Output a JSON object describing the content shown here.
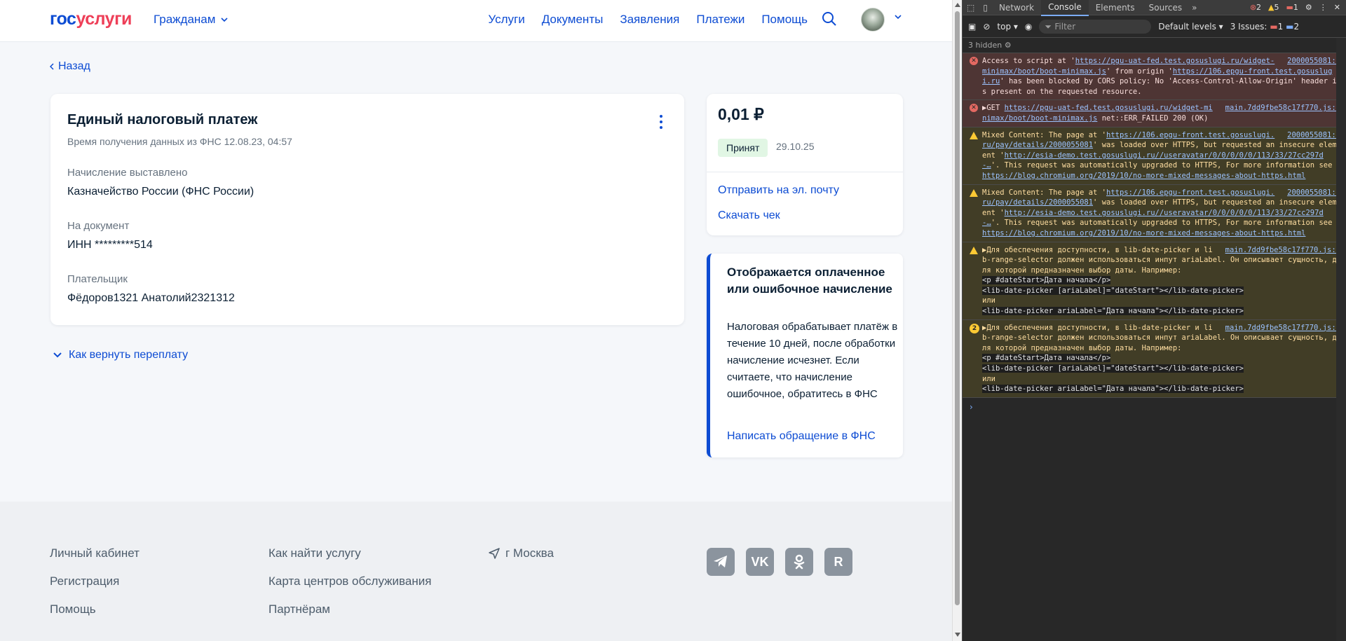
{
  "header": {
    "logo_part1": "гос",
    "logo_part2": "услуги",
    "citizens": "Гражданам",
    "nav": [
      "Услуги",
      "Документы",
      "Заявления",
      "Платежи",
      "Помощь"
    ]
  },
  "back": "Назад",
  "payment": {
    "title": "Единый налоговый платеж",
    "subtitle": "Время получения данных из ФНС 12.08.23, 04:57",
    "fields": [
      {
        "label": "Начисление выставлено",
        "value": "Казначейство России (ФНС России)"
      },
      {
        "label": "На документ",
        "value": "ИНН *********514"
      },
      {
        "label": "Плательщик",
        "value": "Фёдоров1321 Анатолий2321312"
      }
    ],
    "refund_link": "Как вернуть переплату"
  },
  "summary": {
    "amount": "0,01 ₽",
    "status": "Принят",
    "date": "29.10.25",
    "send_email": "Отправить на эл. почту",
    "download": "Скачать чек"
  },
  "info": {
    "title": "Отображается оплаченное или ошибочное начисление",
    "text": "Налоговая обрабатывает платёж в течение 10 дней, после обработки начисление исчезнет. Если считаете, что начисление ошибочное, обратитесь в ФНС",
    "link": "Написать обращение в ФНС"
  },
  "footer": {
    "col1": [
      "Личный кабинет",
      "Регистрация",
      "Помощь"
    ],
    "col2": [
      "Как найти услугу",
      "Карта центров обслуживания",
      "Партнёрам"
    ],
    "location": "г Москва",
    "socials": [
      "telegram-icon",
      "vk-icon",
      "odnoklassniki-icon",
      "rutube-icon"
    ]
  },
  "devtools": {
    "tabs": [
      "Network",
      "Console",
      "Elements",
      "Sources"
    ],
    "counts": {
      "errors": "2",
      "warnings": "5",
      "issues": "1"
    },
    "context": "top",
    "filter_placeholder": "Filter",
    "levels": "Default levels",
    "issues_label": "3 Issues:",
    "issues_err": "1",
    "issues_info": "2",
    "hidden": "3 hidden",
    "messages": [
      {
        "type": "error",
        "src": "2000055081:1",
        "parts": [
          "Access to script at '",
          "https://pgu-uat-fed.test.gosuslugi.ru/widget-minimax/boot/boot-minimax.js",
          "' from origin '",
          "https://106.epgu-front.test.gosuslugi.ru",
          "' has been blocked by CORS policy: No 'Access-Control-Allow-Origin' header is present on the requested resource."
        ]
      },
      {
        "type": "error",
        "src": "main.7dd9fbe58c17f770.js:1",
        "parts": [
          "▶GET ",
          "https://pgu-uat-fed.test.gosuslugi.ru/widget-minimax/boot/boot-minimax.js",
          " net::ERR_FAILED 200 (OK)"
        ]
      },
      {
        "type": "warn",
        "src": "2000055081:1",
        "parts": [
          "Mixed Content: The page at '",
          "https://106.epgu-front.test.gosuslugi.ru/pay/details/2000055081",
          "' was loaded over HTTPS, but requested an insecure element '",
          "http://esia-demo.test.gosuslugi.ru//useravatar/0/0/0/0/0/113/33/27cc297d-…",
          "'. This request was automatically upgraded to HTTPS, For more information see ",
          "https://blog.chromium.org/2019/10/no-more-mixed-messages-about-https.html"
        ]
      },
      {
        "type": "warn",
        "src": "2000055081:1",
        "parts": [
          "Mixed Content: The page at '",
          "https://106.epgu-front.test.gosuslugi.ru/pay/details/2000055081",
          "' was loaded over HTTPS, but requested an insecure element '",
          "http://esia-demo.test.gosuslugi.ru//useravatar/0/0/0/0/0/113/33/27cc297d-…",
          "'. This request was automatically upgraded to HTTPS, For more information see ",
          "https://blog.chromium.org/2019/10/no-more-mixed-messages-about-https.html"
        ]
      },
      {
        "type": "warn",
        "src": "main.7dd9fbe58c17f770.js:1",
        "parts": [
          "▶Для обеспечения доступности, в lib-date-picker и lib-range-selector должен использоваться инпут ariaLabel. Он описывает сущность, для которой предназначен выбор даты. Например:"
        ],
        "code": [
          "<p #dateStart>Дата начала</p>",
          "<lib-date-picker [ariaLabel]=\"dateStart\"></lib-date-picker>",
          "или",
          "<lib-date-picker ariaLabel=\"Дата начала\"></lib-date-picker>"
        ]
      },
      {
        "type": "warn",
        "count": "2",
        "src": "main.7dd9fbe58c17f770.js:1",
        "parts": [
          "▶Для обеспечения доступности, в lib-date-picker и lib-range-selector должен использоваться инпут ariaLabel. Он описывает сущность, для которой предназначен выбор даты. Например:"
        ],
        "code": [
          "<p #dateStart>Дата начала</p>",
          "<lib-date-picker [ariaLabel]=\"dateStart\"></lib-date-picker>",
          "или",
          "<lib-date-picker ariaLabel=\"Дата начала\"></lib-date-picker>"
        ]
      }
    ]
  }
}
